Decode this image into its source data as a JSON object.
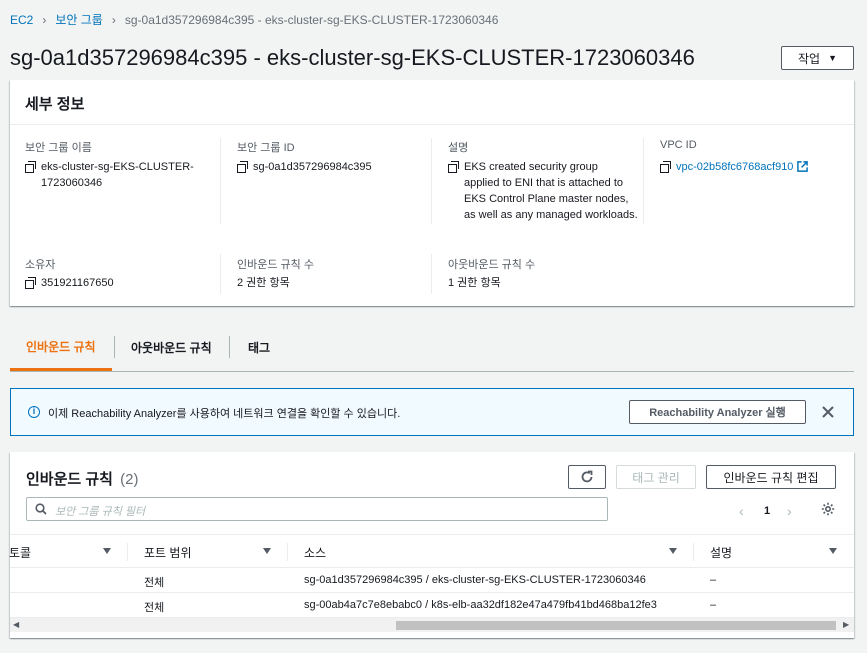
{
  "breadcrumb": {
    "ec2": "EC2",
    "security_groups": "보안 그룹",
    "current": "sg-0a1d357296984c395 - eks-cluster-sg-EKS-CLUSTER-1723060346"
  },
  "page": {
    "title": "sg-0a1d357296984c395 - eks-cluster-sg-EKS-CLUSTER-1723060346",
    "actions_label": "작업"
  },
  "details": {
    "header": "세부 정보",
    "name_label": "보안 그룹 이름",
    "name_line1": "eks-cluster-sg-EKS-CLUSTER-",
    "name_line2": "1723060346",
    "id_label": "보안 그룹 ID",
    "id_value": "sg-0a1d357296984c395",
    "desc_label": "설명",
    "desc_lines": [
      "EKS created security group",
      "applied to ENI that is attached to",
      "EKS Control Plane master nodes,",
      "as well as any managed workloads."
    ],
    "vpc_label": "VPC ID",
    "vpc_value": "vpc-02b58fc6768acf910",
    "owner_label": "소유자",
    "owner_value": "351921167650",
    "inbound_count_label": "인바운드 규칙 수",
    "inbound_count_value": "2 권한 항목",
    "outbound_count_label": "아웃바운드 규칙 수",
    "outbound_count_value": "1 권한 항목"
  },
  "tabs": [
    "인바운드 규칙",
    "아웃바운드 규칙",
    "태그"
  ],
  "banner": {
    "text": "이제 Reachability Analyzer를 사용하여 네트워크 연결을 확인할 수 있습니다.",
    "button": "Reachability Analyzer 실행"
  },
  "rules": {
    "title": "인바운드 규칙",
    "count": "(2)",
    "manage_tags": "태그 관리",
    "edit": "인바운드 규칙 편집",
    "search_placeholder": "보안 그룹 규칙 필터",
    "page": "1",
    "columns": [
      "토콜",
      "포트 범위",
      "소스",
      "설명"
    ],
    "rows": [
      {
        "protocol": "",
        "port": "전체",
        "source": "sg-0a1d357296984c395 / eks-cluster-sg-EKS-CLUSTER-1723060346",
        "desc": "–"
      },
      {
        "protocol": "",
        "port": "전체",
        "source": "sg-00ab4a7c7e8ebabc0 / k8s-elb-aa32df182e47a479fb41bd468ba12fe3",
        "desc": "–"
      }
    ]
  },
  "colors": {
    "accent": "#ec7211",
    "link": "#0073bb",
    "info_bg": "#f1faff"
  }
}
